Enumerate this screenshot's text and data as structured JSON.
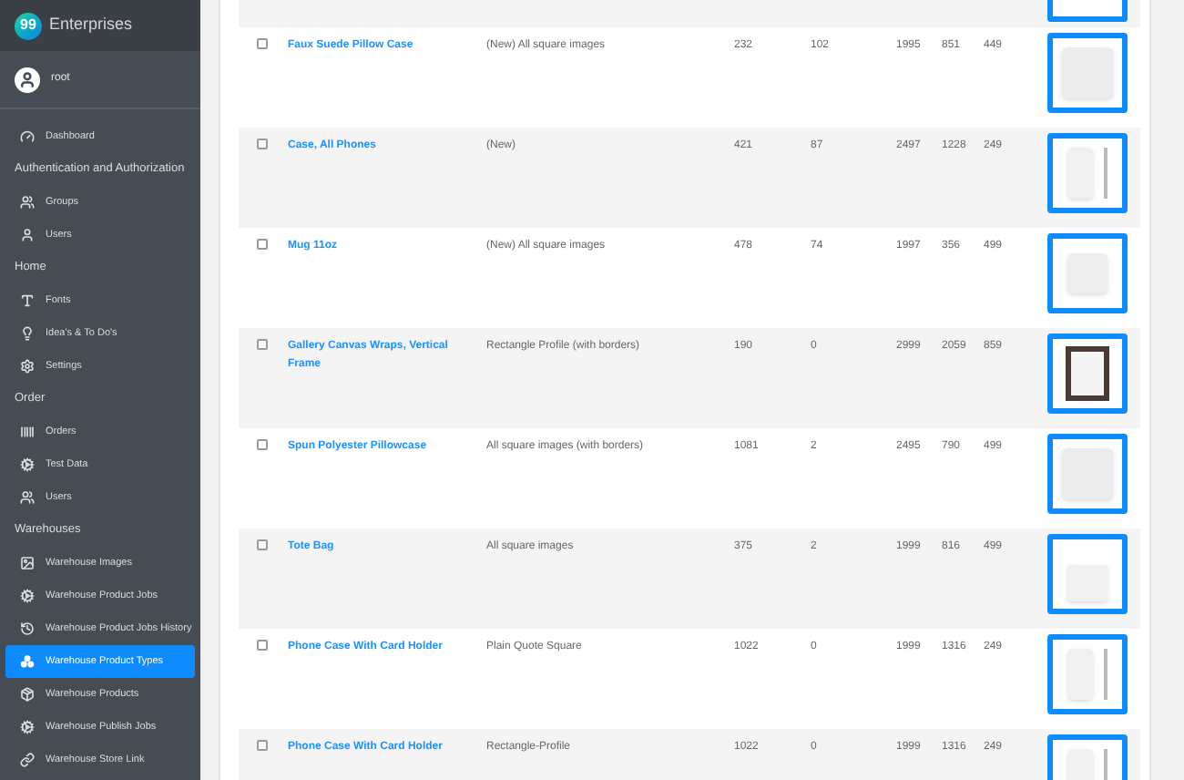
{
  "brand": {
    "logo_text": "99",
    "name": "Enterprises"
  },
  "user": {
    "name": "root"
  },
  "sidebar": {
    "sections": [
      {
        "items": [
          {
            "label": "Dashboard",
            "selected": false
          }
        ]
      },
      {
        "title": "Authentication and Authorization",
        "items": [
          {
            "label": "Groups",
            "selected": false
          },
          {
            "label": "Users",
            "selected": false
          }
        ]
      },
      {
        "title": "Home",
        "items": [
          {
            "label": "Fonts",
            "selected": false
          },
          {
            "label": "Idea's & To Do's",
            "selected": false
          },
          {
            "label": "Settings",
            "selected": false
          }
        ]
      },
      {
        "title": "Order",
        "items": [
          {
            "label": "Orders",
            "selected": false
          },
          {
            "label": "Test Data",
            "selected": false
          },
          {
            "label": "Users",
            "selected": false
          }
        ]
      },
      {
        "title": "Warehouses",
        "items": [
          {
            "label": "Warehouse Images",
            "selected": false
          },
          {
            "label": "Warehouse Product Jobs",
            "selected": false
          },
          {
            "label": "Warehouse Product Jobs History",
            "selected": false
          },
          {
            "label": "Warehouse Product Types",
            "selected": true
          },
          {
            "label": "Warehouse Products",
            "selected": false
          },
          {
            "label": "Warehouse Publish Jobs",
            "selected": false
          },
          {
            "label": "Warehouse Store Link",
            "selected": false
          }
        ]
      }
    ]
  },
  "table": {
    "rows": [
      {
        "checked": false,
        "name": "Faux Suede Pillow Case",
        "description": "(New) All square images",
        "column_3": "232",
        "column_4": "102",
        "column_5": "1995",
        "column_6": "851",
        "column_7": "449"
      },
      {
        "checked": false,
        "name": "Case, All Phones",
        "description": "(New)",
        "column_3": "421",
        "column_4": "87",
        "column_5": "2497",
        "column_6": "1228",
        "column_7": "249"
      },
      {
        "checked": false,
        "name": "Mug 11oz",
        "description": "(New) All square images",
        "column_3": "478",
        "column_4": "74",
        "column_5": "1997",
        "column_6": "356",
        "column_7": "499"
      },
      {
        "checked": false,
        "name": "Gallery Canvas Wraps, Vertical Frame",
        "description": "Rectangle Profile (with borders)",
        "column_3": "190",
        "column_4": "0",
        "column_5": "2999",
        "column_6": "2059",
        "column_7": "859"
      },
      {
        "checked": false,
        "name": "Spun Polyester Pillowcase",
        "description": "All square images (with borders)",
        "column_3": "1081",
        "column_4": "2",
        "column_5": "2495",
        "column_6": "790",
        "column_7": "499"
      },
      {
        "checked": false,
        "name": "Tote Bag",
        "description": "All square images",
        "column_3": "375",
        "column_4": "2",
        "column_5": "1999",
        "column_6": "816",
        "column_7": "499"
      },
      {
        "checked": false,
        "name": "Phone Case With Card Holder",
        "description": "Plain Quote Square",
        "column_3": "1022",
        "column_4": "0",
        "column_5": "1999",
        "column_6": "1316",
        "column_7": "249"
      },
      {
        "checked": false,
        "name": "Phone Case With Card Holder",
        "description": "Rectangle-Profile",
        "column_3": "1022",
        "column_4": "0",
        "column_5": "1999",
        "column_6": "1316",
        "column_7": "249"
      }
    ]
  }
}
